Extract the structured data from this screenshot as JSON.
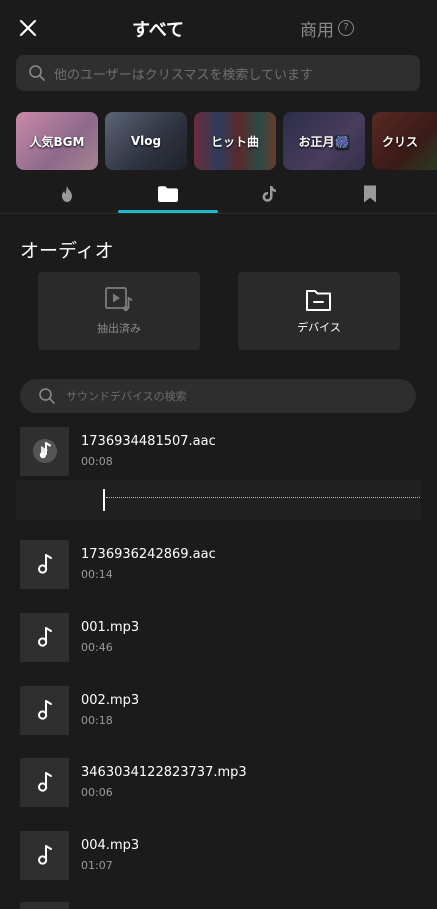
{
  "header": {
    "title": "すべて",
    "commercial_label": "商用",
    "help_glyph": "?"
  },
  "search": {
    "placeholder": "他のユーザーはクリスマスを検索しています"
  },
  "categories": [
    {
      "label": "人気BGM",
      "color": "#b87a96"
    },
    {
      "label": "Vlog",
      "color": "#3d4556"
    },
    {
      "label": "ヒット曲",
      "color": "#4a2f3e"
    },
    {
      "label": "お正月🎆",
      "color": "#3a3550"
    },
    {
      "label": "クリス",
      "color": "#4a2820"
    }
  ],
  "tabs": [
    {
      "name": "trending",
      "icon": "flame-icon"
    },
    {
      "name": "folder",
      "icon": "folder-icon",
      "selected": true
    },
    {
      "name": "tiktok",
      "icon": "tiktok-icon"
    },
    {
      "name": "bookmark",
      "icon": "bookmark-icon"
    }
  ],
  "audio": {
    "section_title": "オーディオ",
    "extracted_label": "抽出済み",
    "device_label": "デバイス"
  },
  "sound_search": {
    "placeholder": "サウンドデバイスの検索"
  },
  "files": [
    {
      "name": "1736934481507.aac",
      "duration": "00:08",
      "playing": true
    },
    {
      "name": "1736936242869.aac",
      "duration": "00:14"
    },
    {
      "name": "001.mp3",
      "duration": "00:46"
    },
    {
      "name": "002.mp3",
      "duration": "00:18"
    },
    {
      "name": "3463034122823737.mp3",
      "duration": "00:06"
    },
    {
      "name": "004.mp3",
      "duration": "01:07"
    }
  ],
  "colors": {
    "background": "#1b1b1b",
    "accent": "#1fb8c8"
  }
}
